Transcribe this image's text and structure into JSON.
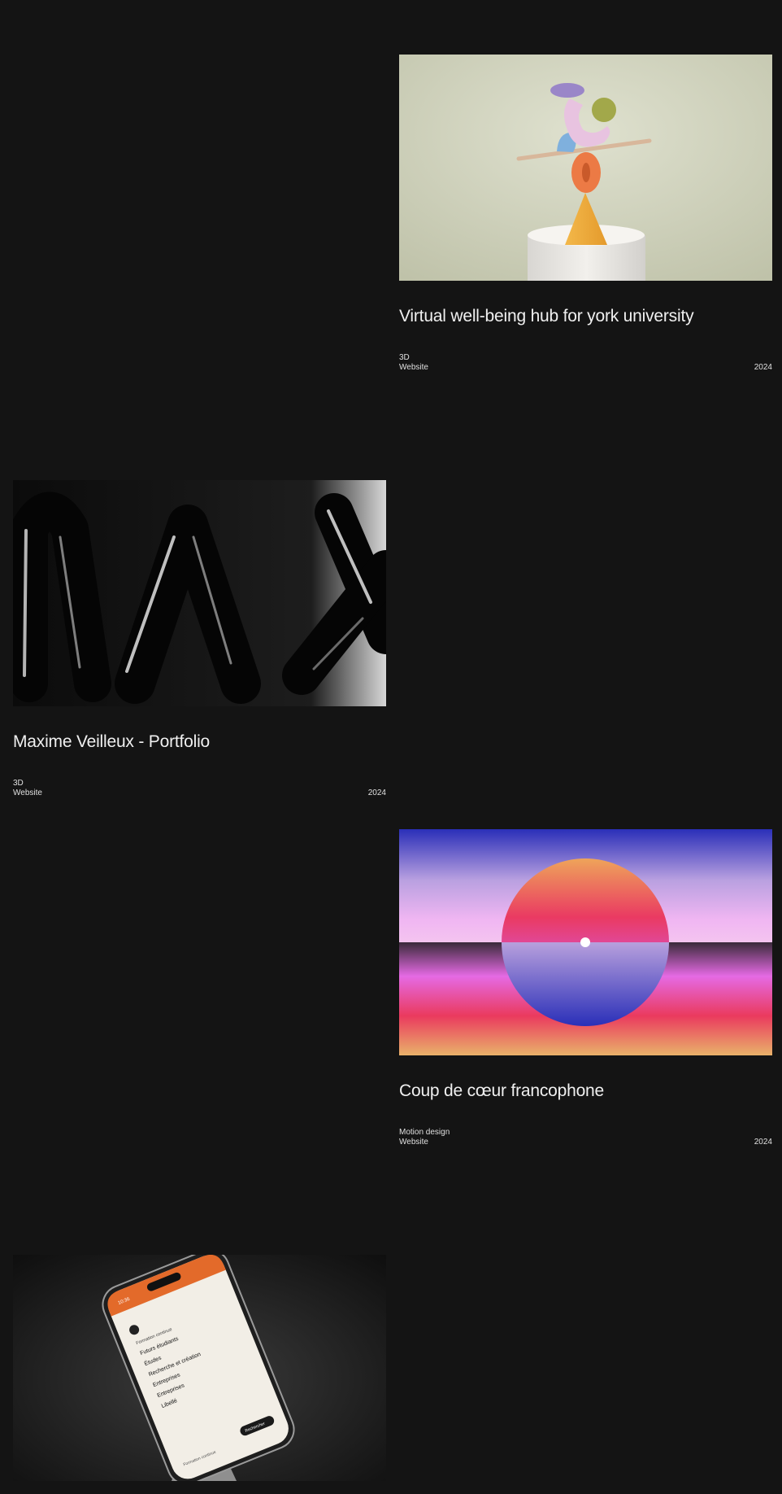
{
  "projects": [
    {
      "title": "Virtual well-being hub for york university",
      "tags": [
        "3D",
        "Website"
      ],
      "year": "2024",
      "image": "abstract-sculpture-balance"
    },
    {
      "title": "Maxime Veilleux - Portfolio",
      "tags": [
        "3D",
        "Website"
      ],
      "year": "2024",
      "image": "glossy-black-letters-max"
    },
    {
      "title": "Coup de cœur francophone",
      "tags": [
        "Motion design",
        "Website"
      ],
      "year": "2024",
      "image": "gradient-sun-horizon"
    },
    {
      "title": "",
      "tags": [],
      "year": "",
      "image": "phone-mockup-website",
      "phone_screen": {
        "time": "10:36",
        "heading": "Formation continue",
        "menu": [
          "Futurs étudiants",
          "Études",
          "Recherche et création",
          "Entreprises",
          "Entreprises",
          "Libellé"
        ],
        "cta": "Rechercher",
        "footer": "Formation continue"
      }
    }
  ],
  "colors": {
    "background": "#141414",
    "text": "#f0f0f0",
    "phone_accent": "#e36a2a"
  }
}
